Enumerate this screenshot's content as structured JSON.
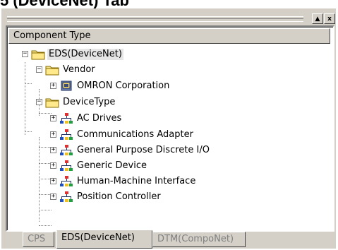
{
  "heading": "5 (DeviceNet) Tab",
  "window_buttons": {
    "maximize": "▲",
    "close": "x"
  },
  "column_header": "Component Type",
  "tree": {
    "root": "EDS(DeviceNet)",
    "vendor_group": "Vendor",
    "vendor_items": [
      "OMRON Corporation"
    ],
    "devicetype_group": "DeviceType",
    "devicetype_items": [
      "AC Drives",
      "Communications Adapter",
      "General Purpose Discrete I/O",
      "Generic Device",
      "Human-Machine Interface",
      "Position Controller"
    ]
  },
  "tabs": [
    "CPS",
    "EDS(DeviceNet)",
    "DTM(CompoNet)"
  ],
  "active_tab": "EDS(DeviceNet)",
  "icons": {
    "folder": "folder-icon",
    "vendor": "vendor-device-icon",
    "network": "network-device-icon"
  }
}
